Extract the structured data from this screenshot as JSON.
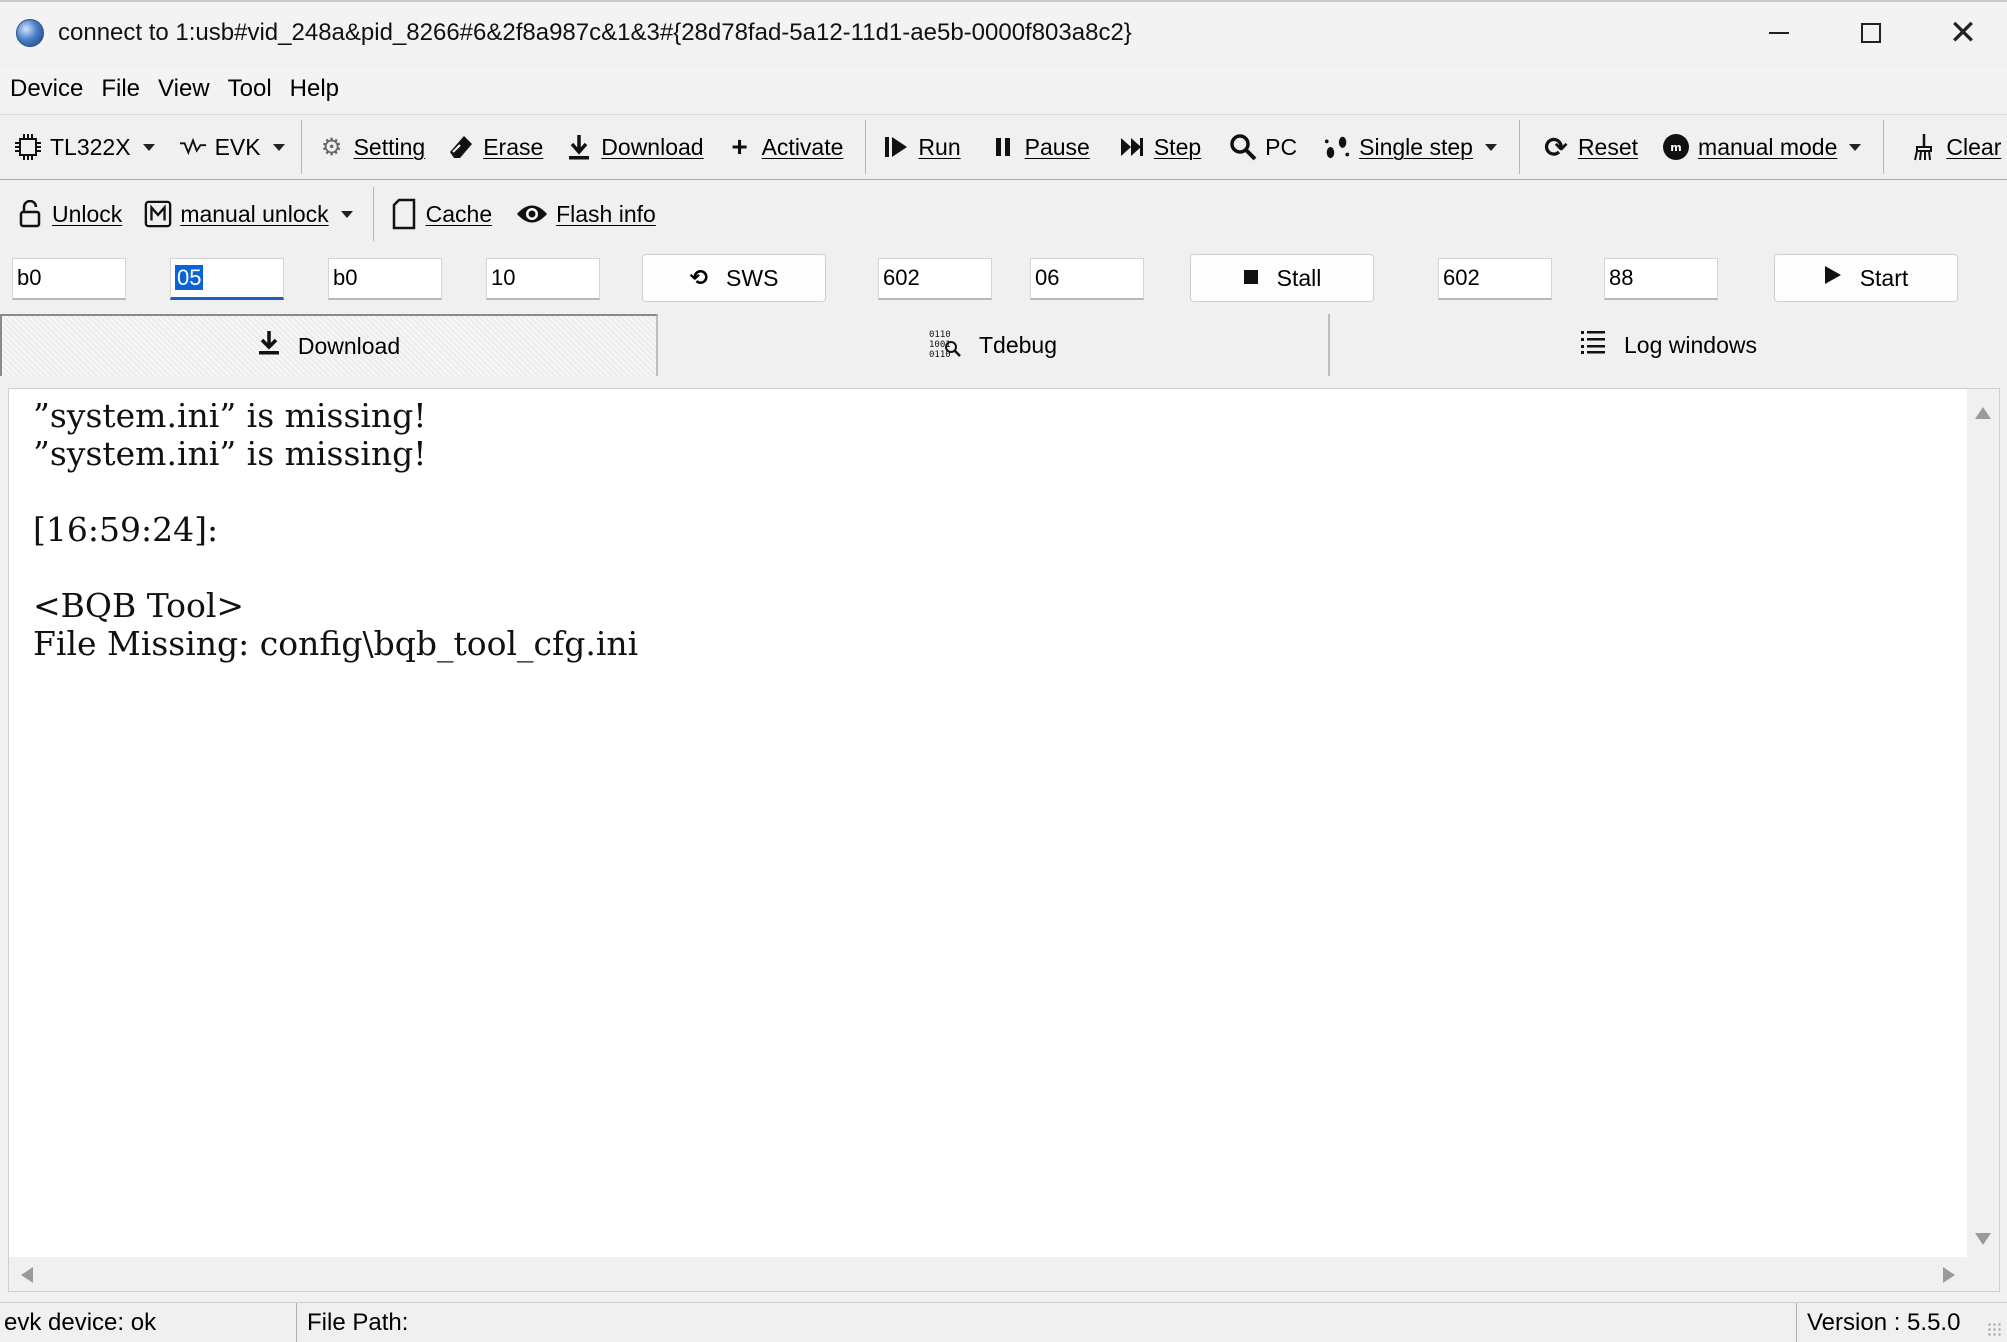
{
  "window": {
    "title": "connect to 1:usb#vid_248a&pid_8266#6&2f8a987c&1&3#{28d78fad-5a12-11d1-ae5b-0000f803a8c2}"
  },
  "menu": [
    "Device",
    "File",
    "View",
    "Tool",
    "Help"
  ],
  "toolbar1": {
    "chip": "TL322X",
    "evk": "EVK",
    "setting": "Setting",
    "erase": "Erase",
    "download": "Download",
    "activate": "Activate",
    "run": "Run",
    "pause": "Pause",
    "step": "Step",
    "pc": "PC",
    "single_step": "Single step",
    "reset": "Reset",
    "manual_mode": "manual mode",
    "clear": "Clear"
  },
  "toolbar2": {
    "unlock": "Unlock",
    "manual_unlock": "manual unlock",
    "cache": "Cache",
    "flash_info": "Flash info"
  },
  "inputs": {
    "f1": "b0",
    "f2": "05",
    "f3": "b0",
    "f4": "10",
    "sws_label": "SWS",
    "f5": "602",
    "f6": "06",
    "stall_label": "Stall",
    "f7": "602",
    "f8": "88",
    "start_label": "Start"
  },
  "tabs": {
    "download": "Download",
    "tdebug": "Tdebug",
    "log": "Log windows"
  },
  "log": {
    "lines": [
      "”system.ini” is missing!",
      "”system.ini” is missing!",
      "",
      "[16:59:24]:",
      "",
      "<BQB Tool>",
      "File Missing: config\\bqb_tool_cfg.ini"
    ]
  },
  "status": {
    "device": "evk device: ok",
    "file_path": "File Path:",
    "version": "Version : 5.5.0"
  },
  "icons": {
    "app": "globe-icon",
    "chip": "chip-icon",
    "evk": "waveform-icon",
    "setting": "gear-icon",
    "erase": "eraser-icon",
    "download": "download-arrow-icon",
    "activate": "plus-icon",
    "run": "run-icon",
    "pause": "pause-icon",
    "step": "step-icon",
    "pc": "search-icon",
    "single_step": "footprints-icon",
    "reset": "refresh-icon",
    "manual_mode": "mode-icon",
    "clear": "broom-icon",
    "unlock": "unlock-icon",
    "manual_unlock": "m-box-icon",
    "cache": "sd-card-icon",
    "flash_info": "eye-icon",
    "sws": "sync-icon",
    "stall": "stop-square-icon",
    "start": "play-icon",
    "tdebug": "binary-icon",
    "log": "list-icon"
  },
  "colors": {
    "selection": "#0a64d6",
    "focus_underline": "#1a5fc4"
  }
}
